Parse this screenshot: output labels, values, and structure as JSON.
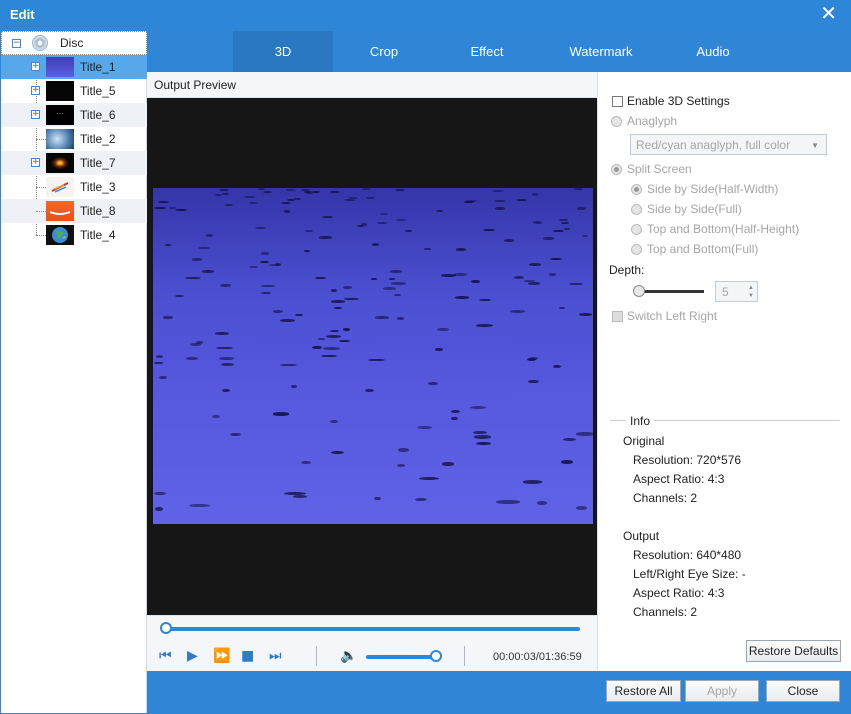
{
  "window": {
    "title": "Edit",
    "close_glyph": "✕"
  },
  "tree": {
    "disc_label": "Disc",
    "items": [
      {
        "label": "Title_1",
        "selected": true,
        "expander": "+",
        "thumb": "water"
      },
      {
        "label": "Title_5",
        "expander": "+",
        "thumb": "black"
      },
      {
        "label": "Title_6",
        "expander": "+",
        "thumb": "black-dots"
      },
      {
        "label": "Title_2",
        "expander": "",
        "thumb": "bluish"
      },
      {
        "label": "Title_7",
        "expander": "+",
        "thumb": "orange-glow"
      },
      {
        "label": "Title_3",
        "expander": "",
        "thumb": "feather"
      },
      {
        "label": "Title_8",
        "expander": "",
        "thumb": "orange"
      },
      {
        "label": "Title_4",
        "expander": "",
        "thumb": "globe"
      }
    ]
  },
  "tabs": [
    "3D",
    "Crop",
    "Effect",
    "Watermark",
    "Audio"
  ],
  "active_tab": "3D",
  "preview": {
    "header": "Output Preview",
    "timecode": "00:00:03/01:36:59",
    "seek_progress": 0.0,
    "volume_level": 1.0
  },
  "settings": {
    "enable_3d": "Enable 3D Settings",
    "anaglyph": "Anaglyph",
    "anaglyph_select": "Red/cyan anaglyph, full color",
    "split_screen": "Split Screen",
    "split_options": [
      "Side by Side(Half-Width)",
      "Side by Side(Full)",
      "Top and Bottom(Half-Height)",
      "Top and Bottom(Full)"
    ],
    "depth_label": "Depth:",
    "depth_value": "5",
    "switch_left_right": "Switch Left Right",
    "restore_defaults": "Restore Defaults"
  },
  "info": {
    "title": "Info",
    "original_heading": "Original",
    "original": [
      "Resolution: 720*576",
      "Aspect Ratio: 4:3",
      "Channels: 2"
    ],
    "output_heading": "Output",
    "output": [
      "Resolution: 640*480",
      "Left/Right Eye Size: -",
      "Aspect Ratio: 4:3",
      "Channels: 2"
    ]
  },
  "footer": {
    "restore_all": "Restore All",
    "apply": "Apply",
    "close": "Close"
  },
  "colors": {
    "accent": "#2f86d6",
    "selection": "#56a8ea"
  }
}
